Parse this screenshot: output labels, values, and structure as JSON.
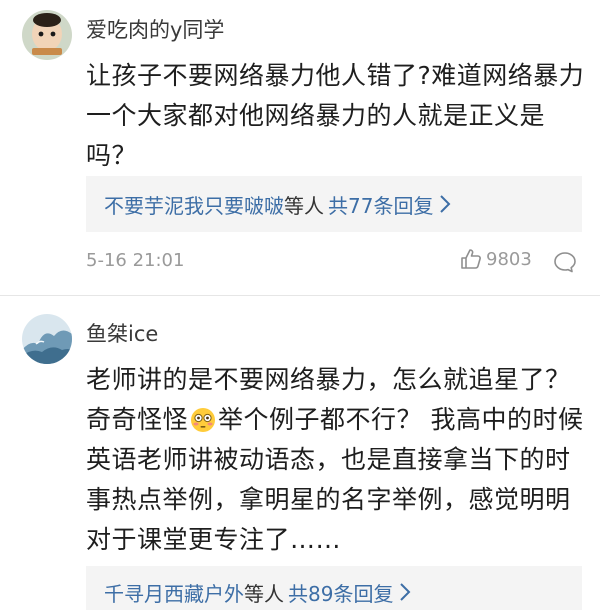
{
  "comments": [
    {
      "username": "爱吃肉的y同学",
      "text": "让孩子不要网络暴力他人错了?难道网络暴力一个大家都对他网络暴力的人就是正义是吗？",
      "replies": {
        "users": "不要芋泥我只要啵啵",
        "connector": "等人",
        "count": "共77条回复"
      },
      "time": "5-16 21:01",
      "likes": "9803"
    },
    {
      "username": "鱼桀ice",
      "text_before": "老师讲的是不要网络暴力，怎么就追星了？奇奇怪怪",
      "emoji": "flushed-face",
      "text_after": "举个例子都不行？ 我高中的时候英语老师讲被动语态，也是直接拿当下的时事热点举例，拿明星的名字举例，感觉明明对于课堂更专注了……",
      "replies": {
        "users": "千寻月西藏户外",
        "connector": "等人",
        "count": "共89条回复"
      }
    }
  ],
  "colors": {
    "link": "#3d6ea6",
    "muted": "#9a9a9a",
    "reply_bg": "#f4f4f4"
  },
  "icons": [
    "chevron-right-icon",
    "thumbs-up-icon",
    "comment-bubble-icon",
    "flushed-face-emoji"
  ]
}
